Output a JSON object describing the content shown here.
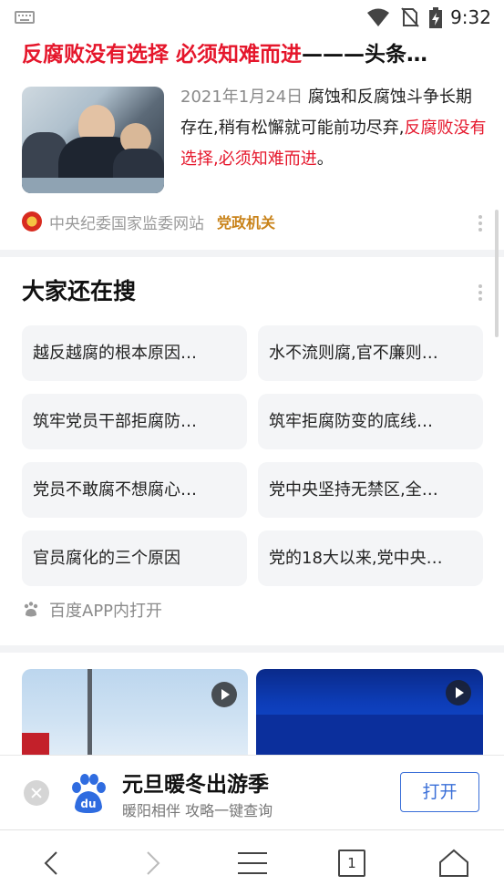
{
  "status_bar": {
    "time": "9:32"
  },
  "result": {
    "title_red": "反腐败没有选择 必须知难而进",
    "title_rest": "———头条…",
    "date": "2021年1月24日",
    "snippet_black": " 腐蚀和反腐蚀斗争长期存在,稍有松懈就可能前功尽弃,",
    "snippet_red": "反腐败没有选择,必须知难而进",
    "snippet_end": "。",
    "source_name": "中央纪委国家监委网站",
    "source_tag": "党政机关"
  },
  "related": {
    "title": "大家还在搜",
    "items": [
      "越反越腐的根本原因…",
      "水不流则腐,官不廉则…",
      "筑牢党员干部拒腐防…",
      "筑牢拒腐防变的底线…",
      "党员不敢腐不想腐心…",
      "党中央坚持无禁区,全…",
      "官员腐化的三个原因",
      "党的18大以来,党中央…"
    ],
    "open_app": "百度APP内打开"
  },
  "banner": {
    "title": "元旦暖冬出游季",
    "subtitle": "暖阳相伴 攻略一键查询",
    "open_label": "打开"
  },
  "navbar": {
    "tab_count": "1"
  },
  "icons": [
    "keyboard-icon",
    "wifi-icon",
    "no-sim-icon",
    "battery-charging-icon",
    "emblem-icon",
    "more-icon",
    "paw-icon",
    "play-icon",
    "close-icon",
    "baidu-logo-icon",
    "back-icon",
    "forward-icon",
    "menu-icon",
    "tabs-icon",
    "home-icon"
  ],
  "colors": {
    "accent_red": "#e5162b",
    "tag_orange": "#c9831a",
    "link_blue": "#3a6fd8"
  }
}
